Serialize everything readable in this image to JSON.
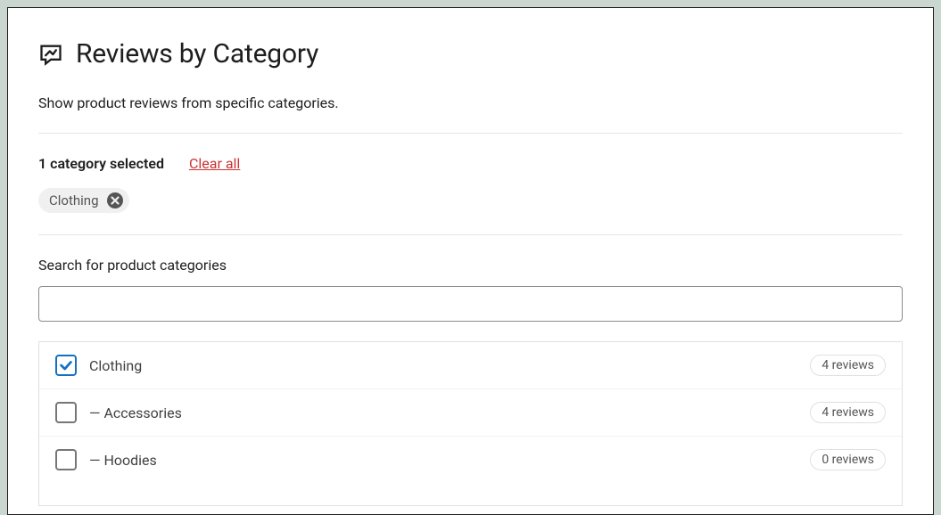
{
  "header": {
    "title": "Reviews by Category"
  },
  "description": "Show product reviews from specific categories.",
  "selection": {
    "count_label": "1 category selected",
    "clear_label": "Clear all"
  },
  "chips": [
    {
      "label": "Clothing"
    }
  ],
  "search": {
    "label": "Search for product categories",
    "value": ""
  },
  "categories": [
    {
      "name": "Clothing",
      "checked": true,
      "indent": 0,
      "reviews_label": "4 reviews"
    },
    {
      "name": "Accessories",
      "checked": false,
      "indent": 1,
      "reviews_label": "4 reviews"
    },
    {
      "name": "Hoodies",
      "checked": false,
      "indent": 1,
      "reviews_label": "0 reviews"
    }
  ],
  "indent_prefix": "— "
}
